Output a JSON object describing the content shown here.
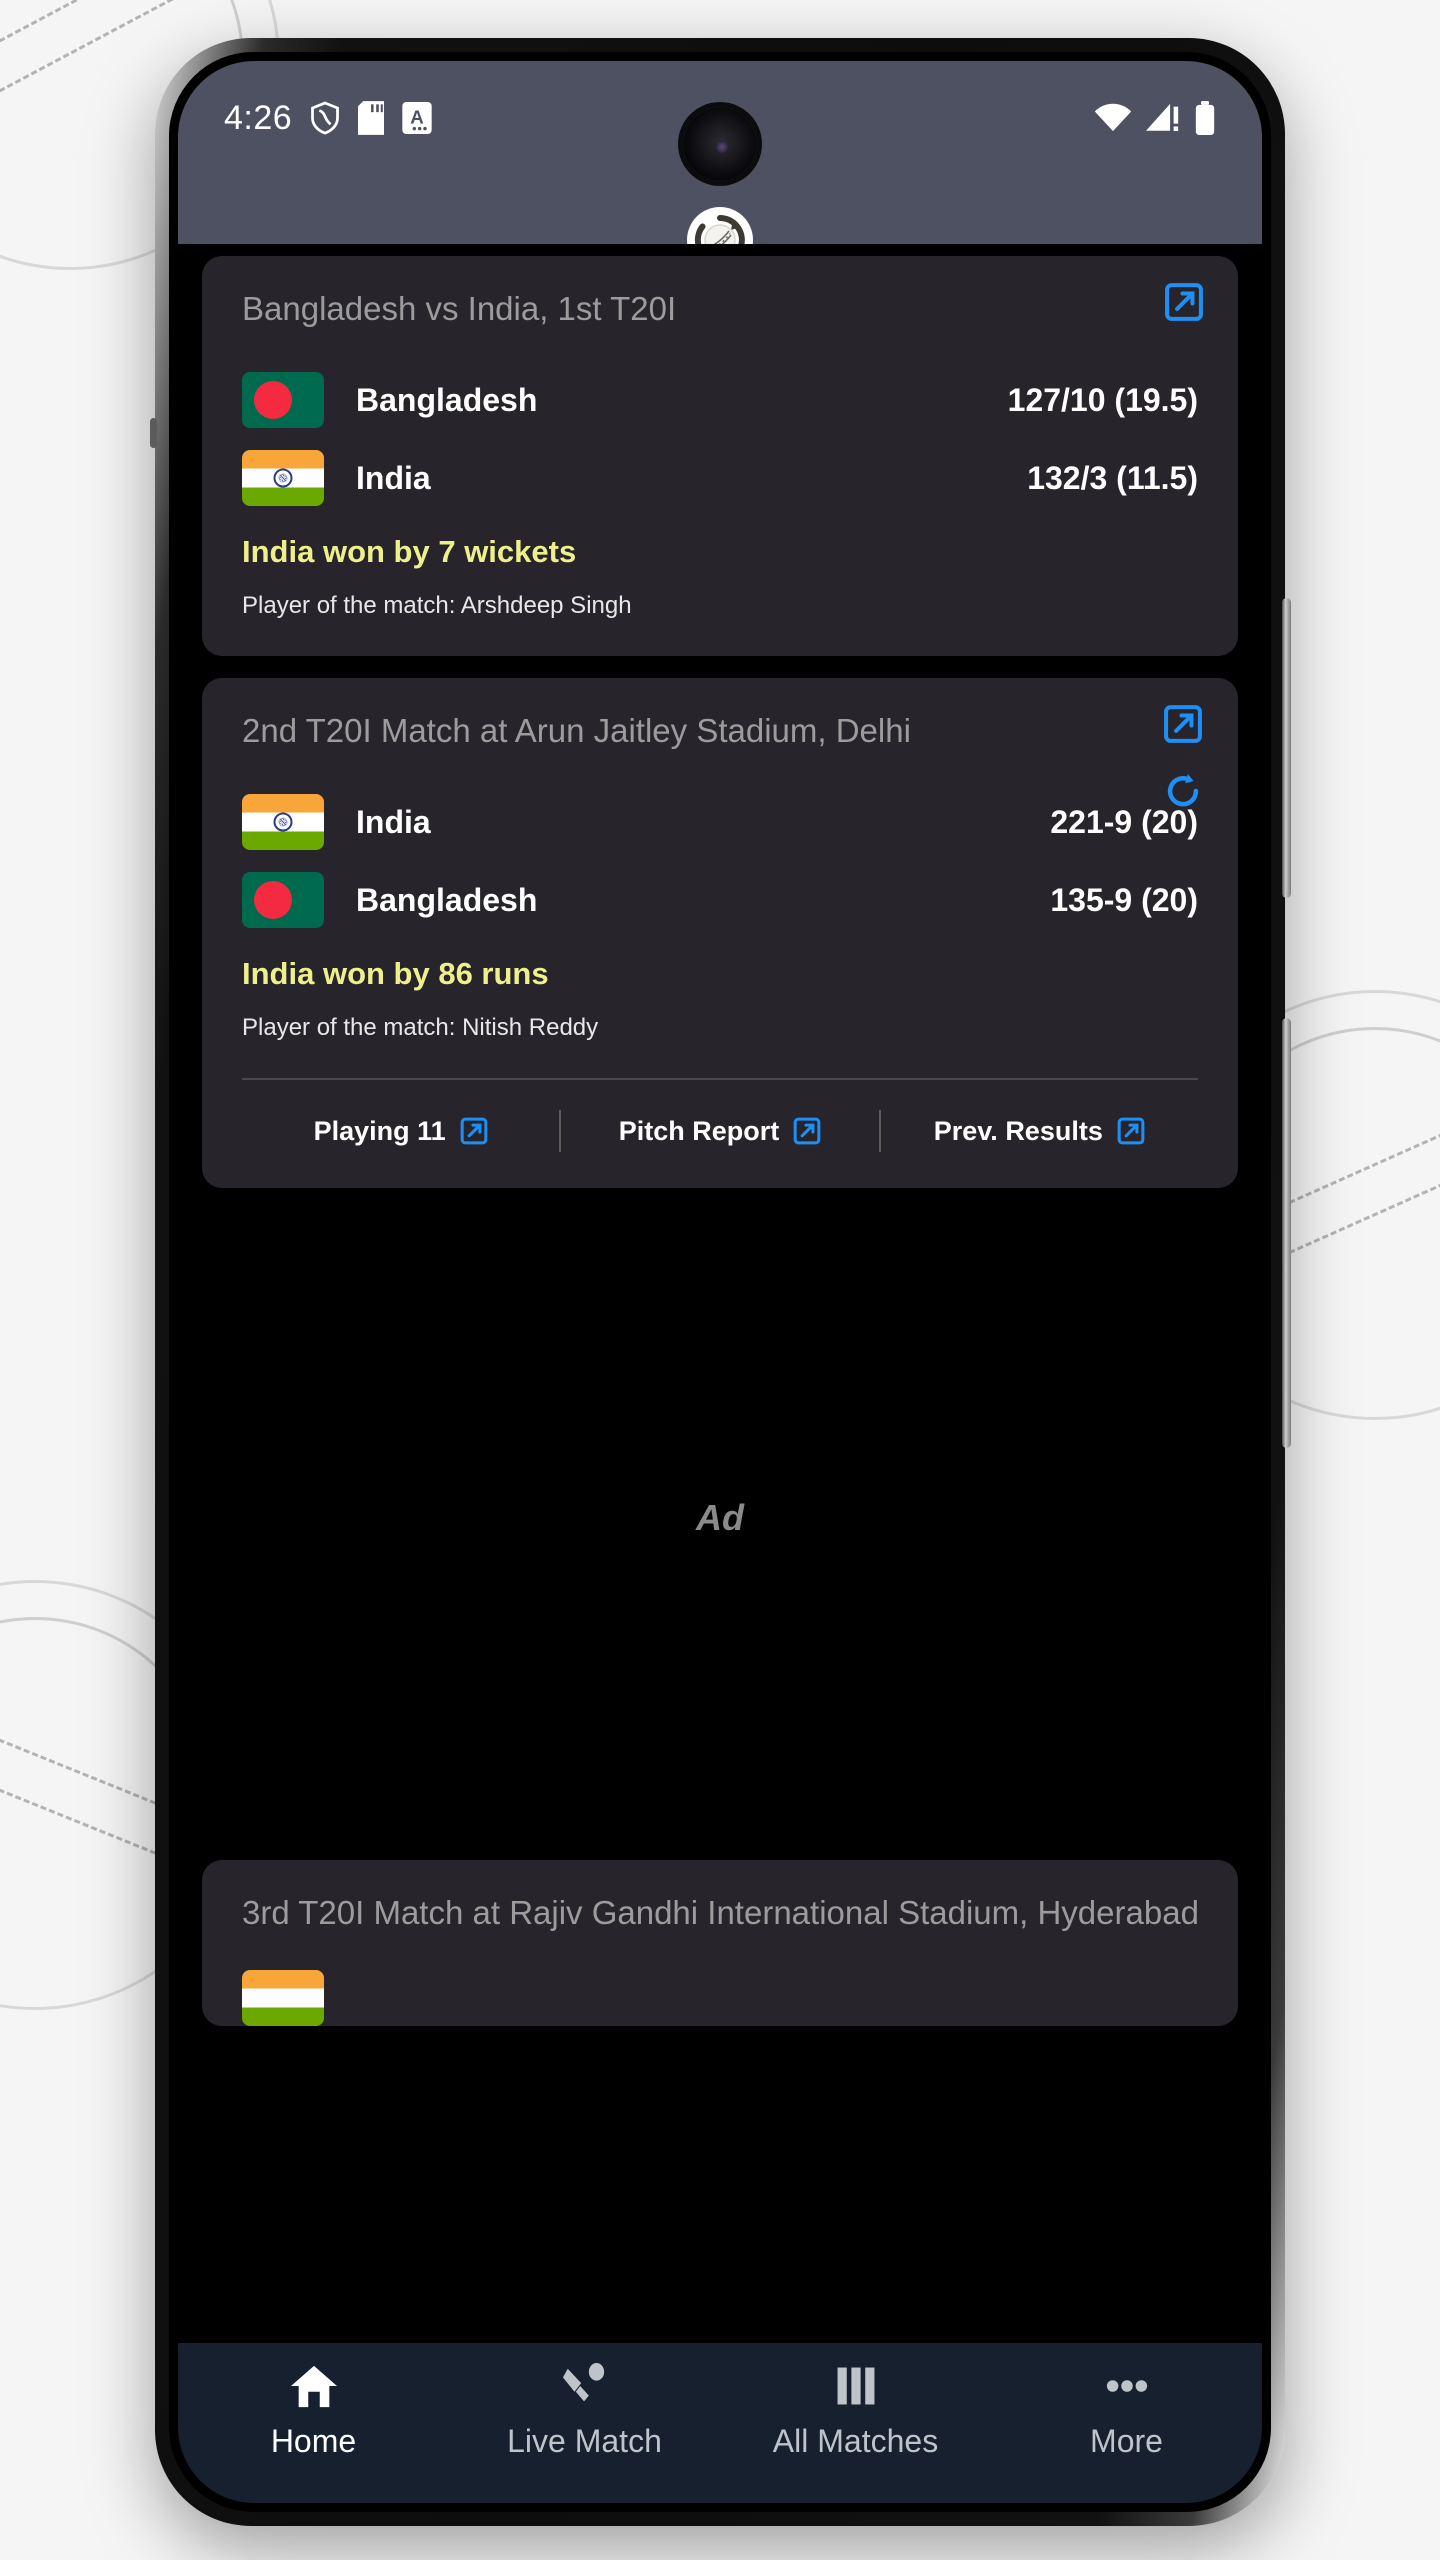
{
  "status_bar": {
    "time": "4:26",
    "left_icons": [
      "shield-icon",
      "sd-card-icon",
      "alphabet-badge-icon"
    ],
    "right_icons": [
      "wifi-icon",
      "cellular-signal-warning-icon",
      "battery-icon"
    ],
    "background_color": "#4e5162"
  },
  "app": {
    "logo_name": "cricket-ball-refresh-logo",
    "background_color": "#000000",
    "card_color": "#27252b",
    "accent_blue": "#2196f3",
    "result_yellow": "#eff08c"
  },
  "cards": [
    {
      "title": "Bangladesh vs India, 1st T20I",
      "teams": [
        {
          "flag": "bangladesh",
          "name": "Bangladesh",
          "score": "127/10 (19.5)"
        },
        {
          "flag": "india",
          "name": "India",
          "score": "132/3 (11.5)"
        }
      ],
      "result": "India won by 7 wickets",
      "player_of_match": "Player of the match: Arshdeep Singh",
      "icons": [
        "external-link-icon"
      ],
      "links": []
    },
    {
      "title": "2nd T20I Match at Arun Jaitley Stadium, Delhi",
      "teams": [
        {
          "flag": "india",
          "name": "India",
          "score": "221-9 (20)"
        },
        {
          "flag": "bangladesh",
          "name": "Bangladesh",
          "score": "135-9 (20)"
        }
      ],
      "result": "India won by 86 runs",
      "player_of_match": "Player of the match: Nitish Reddy",
      "icons": [
        "external-link-icon",
        "refresh-icon"
      ],
      "links": [
        "Playing 11",
        "Pitch Report",
        "Prev. Results"
      ]
    },
    {
      "title": "3rd T20I Match at Rajiv Gandhi International Stadium, Hyderabad",
      "teams": [],
      "result": "",
      "player_of_match": "",
      "icons": [],
      "links": []
    }
  ],
  "ad": {
    "label": "Ad"
  },
  "bottom_nav": {
    "items": [
      {
        "label": "Home",
        "icon": "home-icon",
        "active": true
      },
      {
        "label": "Live Match",
        "icon": "cricket-bat-ball-icon",
        "active": false
      },
      {
        "label": "All Matches",
        "icon": "columns-icon",
        "active": false
      },
      {
        "label": "More",
        "icon": "ellipsis-icon",
        "active": false
      }
    ],
    "background_color": "#16202e"
  }
}
